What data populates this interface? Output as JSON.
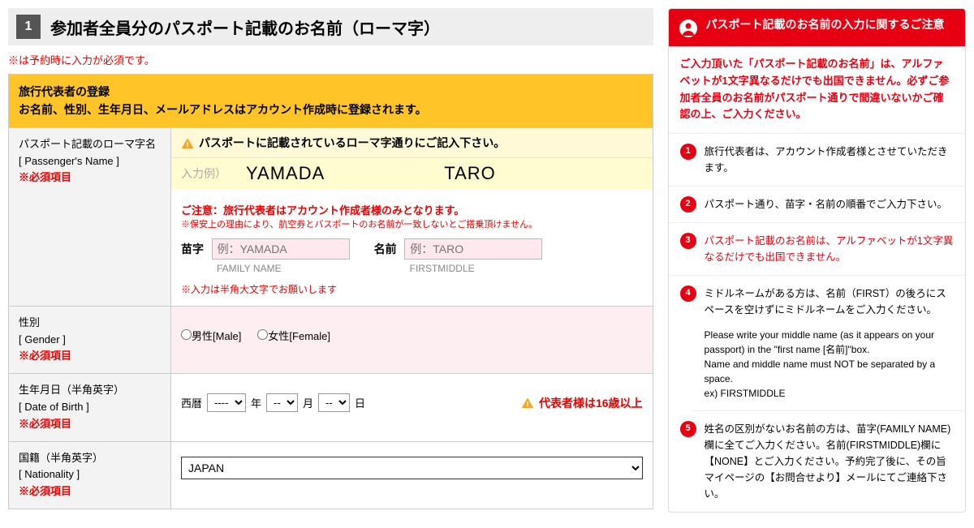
{
  "step": {
    "num": "1",
    "title": "参加者全員分のパスポート記載のお名前（ローマ字）"
  },
  "required_note": "※は予約時に入力が必須です。",
  "yellow_bar": {
    "line1": "旅行代表者の登録",
    "line2": "お名前、性別、生年月日、メールアドレスはアカウント作成時に登録されます。"
  },
  "name_row": {
    "label_jp": "パスポート記載のローマ字名",
    "label_en": "[ Passenger's Name ]",
    "required": "※必須項目",
    "warn": "パスポートに記載されているローマ字通りにご記入下さい。",
    "example_label": "入力例）",
    "example_family": "YAMADA",
    "example_first": "TARO",
    "caution": "ご注意：旅行代表者はアカウント作成者様のみとなります。",
    "caution_sub": "※保安上の理由により、航空券とパスポートのお名前が一致しないとご搭乗頂けません。",
    "family_label": "苗字",
    "family_placeholder": "例：YAMADA",
    "family_en": "FAMILY NAME",
    "first_label": "名前",
    "first_placeholder": "例：TARO",
    "first_en": "FIRSTMIDDLE",
    "halfwidth_note": "※入力は半角大文字でお願いします"
  },
  "gender": {
    "label_jp": "性別",
    "label_en": "[ Gender ]",
    "required": "※必須項目",
    "male": "男性[Male]",
    "female": "女性[Female]"
  },
  "dob": {
    "label_jp": "生年月日（半角英字）",
    "label_en": "[ Date of Birth ]",
    "required": "※必須項目",
    "era": "西暦",
    "year_opt": "----",
    "year_suf": "年",
    "month_opt": "--",
    "month_suf": "月",
    "day_opt": "--",
    "day_suf": "日",
    "age_warn": "代表者様は16歳以上"
  },
  "nat": {
    "label_jp": "国籍（半角英字）",
    "label_en": "[ Nationality ]",
    "required": "※必須項目",
    "value": "JAPAN"
  },
  "side": {
    "title": "パスポート記載のお名前の入力に関するご注意",
    "intro": "ご入力頂いた「パスポート記載のお名前」は、アルファベットが1文字異なるだけでも出国できません。必ずご参加者全員のお名前がパスポート通りで間違いないかご確認の上、ご入力ください。",
    "items": [
      "旅行代表者は、アカウント作成者様とさせていただきます。",
      "パスポート通り、苗字・名前の順番でご入力下さい。",
      "パスポート記載のお名前は、アルファベットが1文字異なるだけでも出国できません。",
      "ミドルネームがある方は、名前（FIRST）の後ろにスペースを空けずにミドルネームをご入力ください。",
      "姓名の区別がないお名前の方は、苗字(FAMILY NAME)欄に全てご入力ください。名前(FIRSTMIDDLE)欄に【NONE】とご入力ください。予約完了後に、その旨マイページの【お問合せより】メールにてご連絡下さい。"
    ],
    "item4_sub": "Please write your middle name (as it appears on your passport) in the \"first name [名前]\"box.\nName and middle name must NOT be separated by a space.\nex) FIRSTMIDDLE"
  }
}
